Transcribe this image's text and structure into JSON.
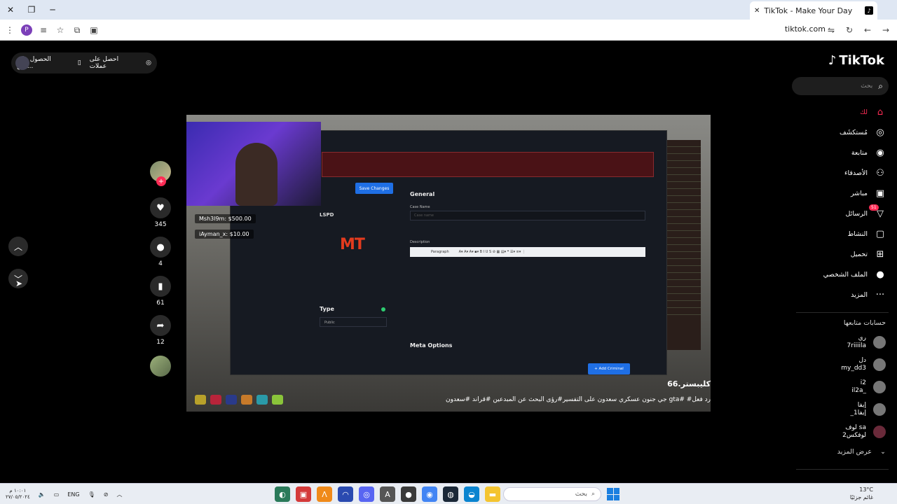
{
  "browser": {
    "tab_title": "TikTok - Make Your Day",
    "url": "tiktok.com",
    "tab_favicon": "tiktok-icon"
  },
  "promo": {
    "item1": "احصل على عملات",
    "item2": "الحصول على التن..."
  },
  "video": {
    "dashboard": {
      "save_label": "Save Changes",
      "dept": "LSPD",
      "logo_text": "MT",
      "general": "General",
      "case_name_label": "Case Name",
      "case_placeholder": "Case name",
      "description_label": "Description",
      "paragraph": "Paragraph",
      "type_label": "Type",
      "type_value": "Public",
      "meta_label": "Meta Options",
      "add_criminal": "+ Add Criminal"
    },
    "donations": [
      "Msh3l9m: $500.00",
      "iAyman_x: $10.00"
    ],
    "author": "كليبستر.66",
    "caption": "جي جنون عسكري سعدون على التفسير#رؤى البحث عن المبدعين #قراند #سعدون gta# #رد فعل"
  },
  "actions": {
    "likes": "345",
    "comments": "4",
    "saves": "61",
    "shares": "12"
  },
  "sidebar": {
    "logo": "TikTok",
    "search_placeholder": "بحث",
    "nav": [
      {
        "label": "لك",
        "icon": "home-icon",
        "active": true
      },
      {
        "label": "مُستكشَف",
        "icon": "compass-icon"
      },
      {
        "label": "متابعة",
        "icon": "following-icon"
      },
      {
        "label": "الأصدقاء",
        "icon": "friends-icon"
      },
      {
        "label": "مباشر",
        "icon": "live-icon"
      },
      {
        "label": "الرسائل",
        "icon": "messages-icon",
        "badge": "51"
      },
      {
        "label": "النشاط",
        "icon": "activity-icon"
      },
      {
        "label": "تحميل",
        "icon": "upload-icon"
      },
      {
        "label": "الملف الشخصي",
        "icon": "profile-icon"
      },
      {
        "label": "المزيد",
        "icon": "more-icon"
      }
    ],
    "following_title": "حسابات متابعها",
    "accounts": [
      {
        "name": "ري",
        "handle": "7riiiila"
      },
      {
        "name": "دل",
        "handle": "my_dd3"
      },
      {
        "name": "i2",
        "handle": "il2a_"
      },
      {
        "name": "إيفا",
        "handle": "_إيفا1"
      },
      {
        "name": "لوف sa",
        "handle": "2لوفكس"
      }
    ],
    "see_more": "عرض المزيد"
  },
  "taskbar": {
    "lang": "ENG",
    "time": "١٠:٠١ م",
    "date": "٢٧/٠٥/٢٠٢٤",
    "search_placeholder": "بحث",
    "temp": "13°C",
    "weather": "غائم جزئيًا"
  }
}
